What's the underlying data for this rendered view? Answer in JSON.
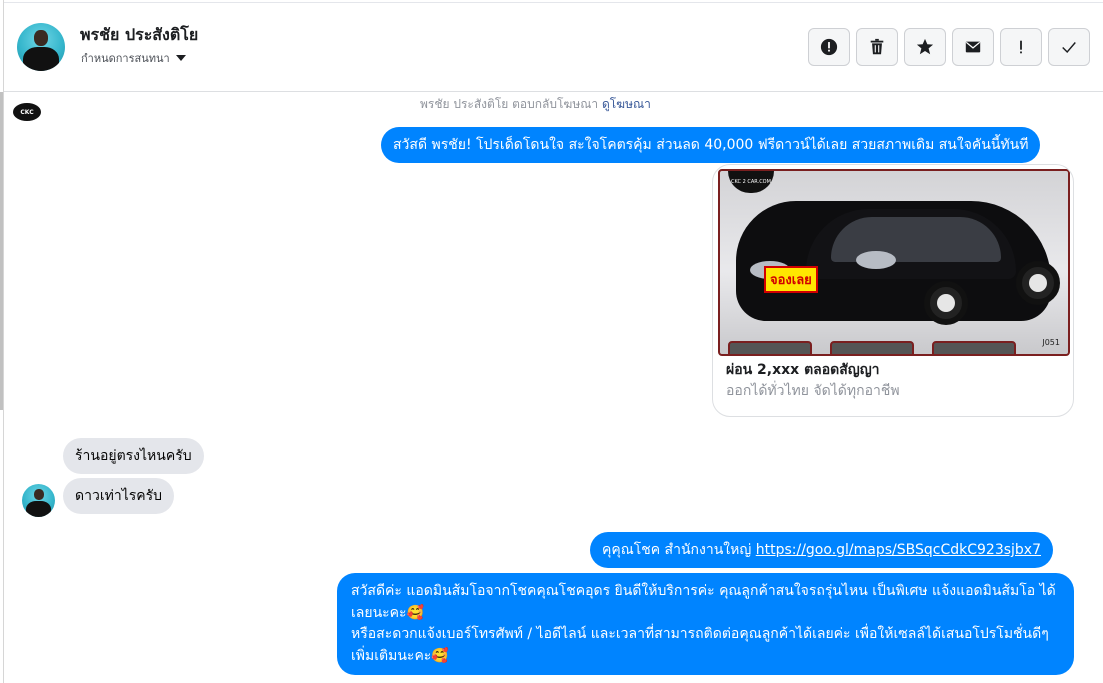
{
  "header": {
    "contact_name": "พรชัย ประสังติโย",
    "subtitle": "กำหนดการสนทนา",
    "actions": [
      {
        "name": "report-button",
        "icon": "alert-circle-icon"
      },
      {
        "name": "delete-button",
        "icon": "trash-icon"
      },
      {
        "name": "star-button",
        "icon": "star-icon"
      },
      {
        "name": "mark-unread-button",
        "icon": "envelope-icon"
      },
      {
        "name": "follow-up-button",
        "icon": "exclamation-icon"
      },
      {
        "name": "done-button",
        "icon": "checkmark-icon"
      }
    ]
  },
  "chat": {
    "ad_reply_note": "พรชัย ประสังติโย ตอบกลับโฆษณา",
    "ad_reply_link": "ดูโฆษณา",
    "messages": {
      "greeting": "สวัสดี พรชัย! โปรเด็ดโดนใจ สะใจโคตรคุ้ม ส่วนลด 40,000 ฟรีดาวน์ได้เลย สวยสภาพเดิม สนใจคันนี้ทันที",
      "incoming_1": "ร้านอยู่ตรงไหนครับ",
      "incoming_2": "ดาวเท่าไรครับ",
      "link_prefix": "คุคุณโชค สำนักงานใหญ่ ",
      "link_url": "https://goo.gl/maps/SBSqcCdkC923sjbx7",
      "long_line1": "สวัสดีค่ะ แอดมินส้มโอจากโชคคุณโชคอุดร ยินดีให้บริการค่ะ   คุณลูกค้าสนใจรถรุ่นไหน เป็นพิเศษ แจ้งแอดมินส้มโอ ได้เลยนะคะ🥰",
      "long_line2": "หรือสะดวกแจ้งเบอร์โทรศัพท์ / ไอดีไลน์ และเวลาที่สามารถติดต่อคุณลูกค้าได้เลยค่ะ เพื่อให้เซลล์ได้เสนอโปรโมชั่นดีๆเพิ่มเติมนะคะ🥰"
    },
    "ad_card": {
      "title": "ผ่อน 2,xxx ตลอดสัญญา",
      "subtitle": "ออกได้ทั่วไทย จัดได้ทุกอาชีพ",
      "badge": "จองเลย",
      "code": "J051",
      "logo_text": "CKC 2 CAR.COM"
    },
    "page_avatar_text": "CKC"
  },
  "colors": {
    "outgoing_bubble": "#0084ff",
    "incoming_bubble": "#e4e6eb"
  }
}
